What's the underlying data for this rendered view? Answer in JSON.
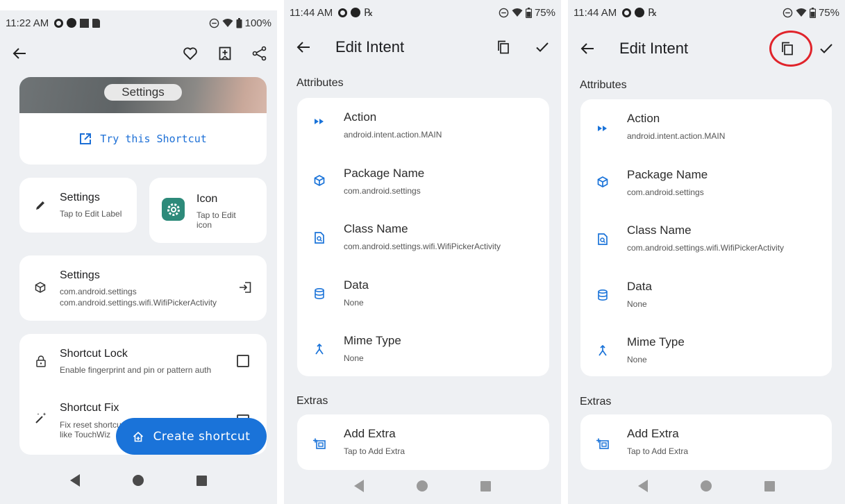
{
  "screen1": {
    "status": {
      "time": "11:22 AM",
      "battery": "100%"
    },
    "banner_label": "Settings",
    "try_shortcut": "Try this Shortcut",
    "label_card": {
      "title": "Settings",
      "subtitle": "Tap to Edit Label"
    },
    "icon_card": {
      "title": "Icon",
      "subtitle": "Tap to Edit icon"
    },
    "intent_card": {
      "title": "Settings",
      "line1": "com.android.settings",
      "line2": "com.android.settings.wifi.WifiPickerActivity"
    },
    "lock": {
      "title": "Shortcut Lock",
      "subtitle": "Enable fingerprint and pin or pattern auth"
    },
    "fix": {
      "title": "Shortcut Fix",
      "subtitle1": "Fix reset shortcu",
      "subtitle2": "like TouchWiz"
    },
    "fab_label": "Create shortcut"
  },
  "screen2": {
    "status": {
      "time": "11:44 AM",
      "battery": "75%"
    },
    "title": "Edit Intent",
    "attributes_header": "Attributes",
    "attributes": [
      {
        "label": "Action",
        "value": "android.intent.action.MAIN"
      },
      {
        "label": "Package Name",
        "value": "com.android.settings"
      },
      {
        "label": "Class Name",
        "value": "com.android.settings.wifi.WifiPickerActivity"
      },
      {
        "label": "Data",
        "value": "None"
      },
      {
        "label": "Mime Type",
        "value": "None"
      }
    ],
    "extras_header": "Extras",
    "extra": {
      "label": "Add Extra",
      "value": "Tap to Add Extra"
    }
  },
  "screen3": {
    "status": {
      "time": "11:44 AM",
      "battery": "75%"
    },
    "title": "Edit Intent",
    "attributes_header": "Attributes",
    "attributes": [
      {
        "label": "Action",
        "value": "android.intent.action.MAIN"
      },
      {
        "label": "Package Name",
        "value": "com.android.settings"
      },
      {
        "label": "Class Name",
        "value": "com.android.settings.wifi.WifiPickerActivity"
      },
      {
        "label": "Data",
        "value": "None"
      },
      {
        "label": "Mime Type",
        "value": "None"
      }
    ],
    "extras_header": "Extras",
    "extra": {
      "label": "Add Extra",
      "value": "Tap to Add Extra"
    }
  },
  "colors": {
    "accent": "#1a73d9",
    "highlight": "#e0242b",
    "background": "#eef0f3"
  }
}
